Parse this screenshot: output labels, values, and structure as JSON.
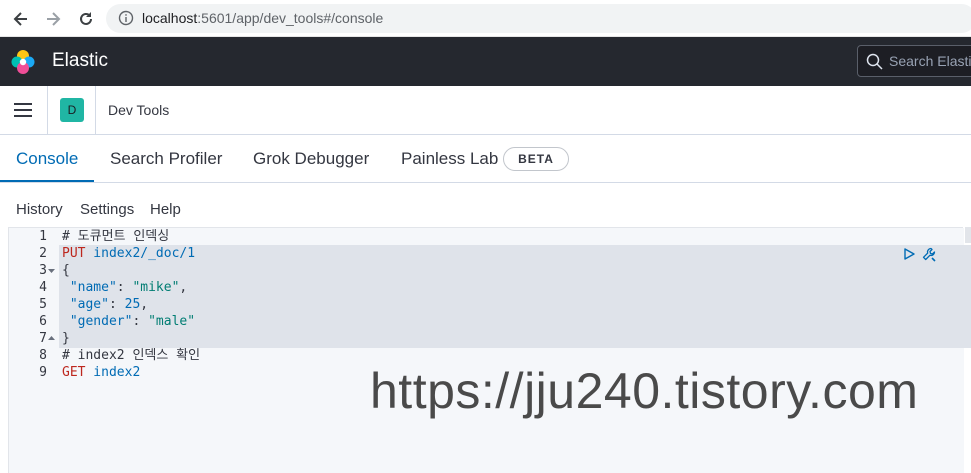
{
  "browser": {
    "url_host": "localhost",
    "url_path": ":5601/app/dev_tools#/console"
  },
  "header": {
    "brand": "Elastic",
    "search_placeholder": "Search Elastic"
  },
  "breadcrumb": {
    "space_initial": "D",
    "title": "Dev Tools"
  },
  "tabs": [
    {
      "label": "Console",
      "active": true
    },
    {
      "label": "Search Profiler"
    },
    {
      "label": "Grok Debugger"
    },
    {
      "label": "Painless Lab"
    }
  ],
  "beta_badge": "BETA",
  "console_menu": [
    "History",
    "Settings",
    "Help"
  ],
  "editor": {
    "line_numbers": [
      "1",
      "2",
      "3",
      "4",
      "5",
      "6",
      "7",
      "8",
      "9"
    ],
    "lines": {
      "l1_comment": "# 도큐먼트 인덱싱",
      "l2_method": "PUT",
      "l2_url": " index2/_doc/1",
      "l3": "{",
      "l4_key": " \"name\"",
      "l4_sep": ": ",
      "l4_val": "\"mike\"",
      "l4_end": ",",
      "l5_key": " \"age\"",
      "l5_sep": ": ",
      "l5_val": "25",
      "l5_end": ",",
      "l6_key": " \"gender\"",
      "l6_sep": ": ",
      "l6_val": "\"male\"",
      "l7": "}",
      "l8_comment": "# index2 인덱스 확인",
      "l9_method": "GET",
      "l9_url": " index2"
    }
  },
  "watermark": "https://jju240.tistory.com",
  "colors": {
    "header_bg": "#25282f",
    "accent": "#006bb4",
    "method": "#bd271e",
    "string": "#017d73",
    "avatar": "#20b6a4"
  }
}
